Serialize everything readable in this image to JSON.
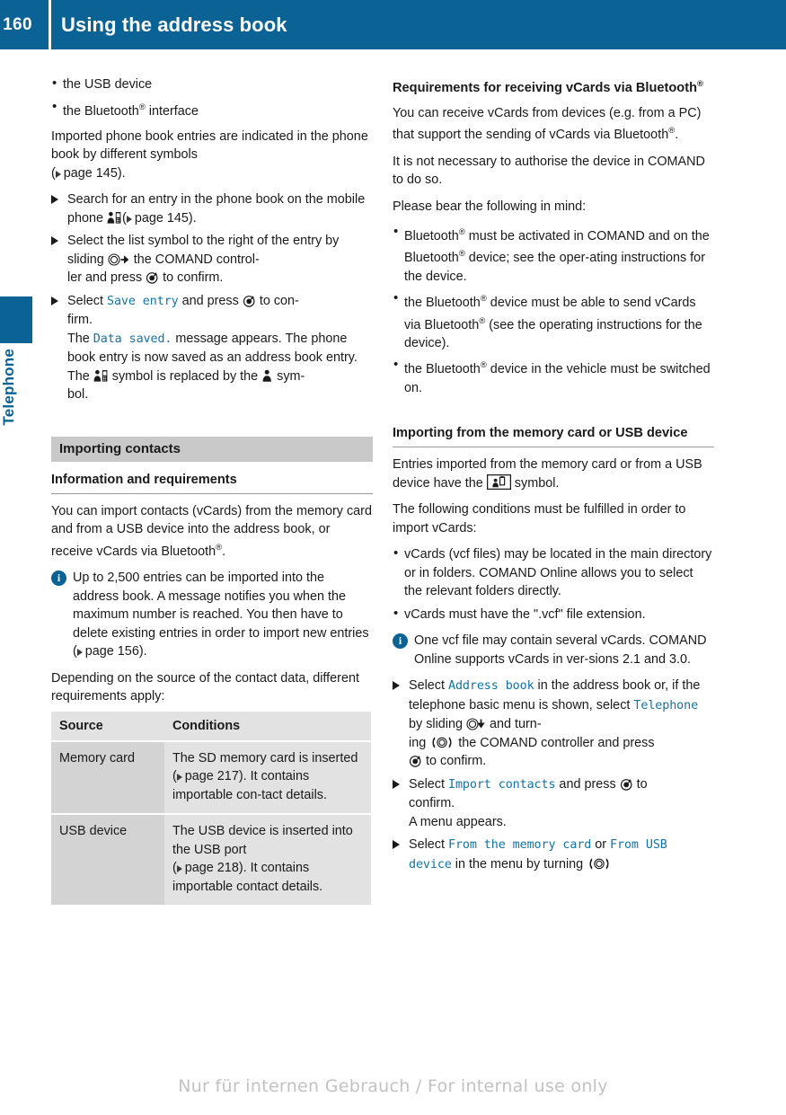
{
  "colors": {
    "brand_blue": "#0a6394",
    "menu_text_blue": "#1273a8",
    "section_bar_gray": "#c9c9c9",
    "table_header_gray": "#e2e2e2",
    "table_cell_gray": "#d3d3d3",
    "watermark_gray": "#c2c2c2"
  },
  "header": {
    "page_number": "160",
    "title": "Using the address book"
  },
  "sidebar": {
    "tab_label": "Telephone"
  },
  "footer": {
    "watermark": "Nur für internen Gebrauch / For internal use only"
  },
  "left_column": {
    "bullets_top": [
      "the USB device",
      "the Bluetooth® interface"
    ],
    "para_imported": "Imported phone book entries are indicated in the phone book by different symbols (▷ page 145).",
    "steps": [
      {
        "text_before_icon": "Search for an entry in the phone book on the mobile phone ",
        "icon": "phonebook-contact-icon",
        "text_after_icon": "(▷ page 145)."
      },
      {
        "part1": "Select the list symbol to the right of the entry by sliding ",
        "icon1": "controller-slide-right-icon",
        "part2": " the COMAND control-ler and press ",
        "icon2": "controller-press-icon",
        "part3": " to confirm."
      },
      {
        "part1": "Select ",
        "menu1": "Save entry",
        "part2": " and press ",
        "icon1": "controller-press-icon",
        "part3": " to confirm.",
        "sub1_pre": "The ",
        "sub1_menu": "Data saved.",
        "sub1_post": " message appears. The phone book entry is now saved as an address book entry.",
        "sub2_pre": "The ",
        "sub2_icon1": "phonebook-contact-icon",
        "sub2_mid": " symbol is replaced by the ",
        "sub2_icon2": "addressbook-contact-icon",
        "sub2_post": " symbol."
      }
    ],
    "section_bar": "Importing contacts",
    "heading_info": "Information and requirements",
    "para_import": "You can import contacts (vCards) from the memory card and from a USB device into the address book, or receive vCards via Bluetooth®.",
    "note": "Up to 2,500 entries can be imported into the address book. A message notifies you when the maximum number is reached. You then have to delete existing entries in order to import new entries (▷ page 156).",
    "para_depending": "Depending on the source of the contact data, different requirements apply:",
    "table": {
      "headers": [
        "Source",
        "Conditions"
      ],
      "rows": [
        [
          "Memory card",
          "The SD memory card is inserted (▷ page 217). It contains importable contact details."
        ],
        [
          "USB device",
          "The USB device is inserted into the USB port (▷ page 218). It contains importable contact details."
        ]
      ]
    }
  },
  "right_column": {
    "heading_requirements": "Requirements for receiving vCards via Bluetooth®",
    "para_receive": "You can receive vCards from devices (e.g. from a PC) that support the sending of vCards via Bluetooth®.",
    "para_authorise": "It is not necessary to authorise the device in COMAND to do so.",
    "para_bear": "Please bear the following in mind:",
    "bullets": [
      "Bluetooth® must be activated in COMAND and on the Bluetooth® device; see the operating instructions for the device.",
      "the Bluetooth® device must be able to send vCards via Bluetooth® (see the operating instructions for the device).",
      "the Bluetooth® device in the vehicle must be switched on."
    ],
    "heading_importing": "Importing from the memory card or USB device",
    "para_entries_pre": "Entries imported from the memory card or from a USB device have the ",
    "para_entries_icon": "imported-vcard-icon",
    "para_entries_post": " symbol.",
    "para_conditions": "The following conditions must be fulfilled in order to import vCards:",
    "bullets2": [
      "vCards (vcf files) may be located in the main directory or in folders. COMAND Online allows you to select the relevant folders directly.",
      "vCards must have the \".vcf\" file extension."
    ],
    "note": "One vcf file may contain several vCards. COMAND Online supports vCards in versions 2.1 and 3.0.",
    "steps": [
      {
        "part1": "Select ",
        "menu1": "Address book",
        "part2": " in the address book or, if the telephone basic menu is shown, select ",
        "menu2": "Telephone",
        "part3": " by sliding ",
        "icon1": "controller-slide-down-icon",
        "part4": " and turning ",
        "icon2": "controller-turn-icon",
        "part5": " the COMAND controller and press ",
        "icon3": "controller-press-icon",
        "part6": " to confirm."
      },
      {
        "part1": "Select ",
        "menu1": "Import contacts",
        "part2": " and press ",
        "icon1": "controller-press-icon",
        "part3": " to confirm.",
        "sub1": "A menu appears."
      },
      {
        "part1": "Select ",
        "menu1": "From the memory card",
        "part2": " or ",
        "menu2": "From USB device",
        "part3": " in the menu by turning ",
        "icon1": "controller-turn-icon"
      }
    ]
  }
}
